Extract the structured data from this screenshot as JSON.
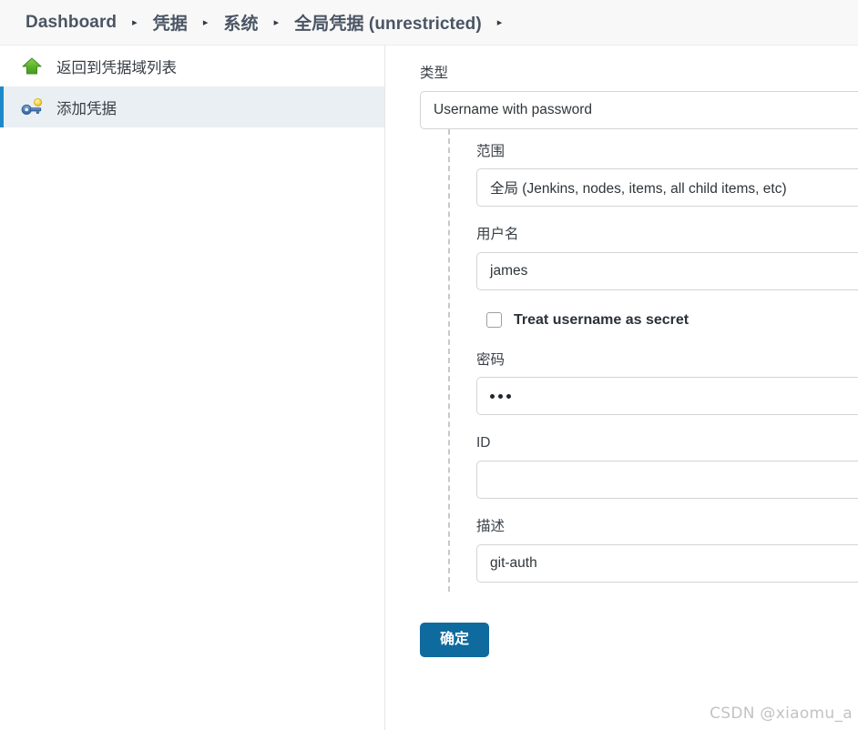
{
  "breadcrumb": {
    "separator": "▸",
    "items": [
      {
        "label": "Dashboard"
      },
      {
        "label": "凭据"
      },
      {
        "label": "系统"
      },
      {
        "label": "全局凭据 (unrestricted)"
      }
    ],
    "trailing_separator": "▸"
  },
  "sidebar": {
    "items": [
      {
        "label": "返回到凭据域列表",
        "icon": "green-up-arrow-icon",
        "active": false
      },
      {
        "label": "添加凭据",
        "icon": "key-add-icon",
        "active": true
      }
    ]
  },
  "form": {
    "type": {
      "label": "类型",
      "value": "Username with password"
    },
    "scope": {
      "label": "范围",
      "value": "全局 (Jenkins, nodes, items, all child items, etc)"
    },
    "username": {
      "label": "用户名",
      "value": "james",
      "placeholder": ""
    },
    "treat_as_secret": {
      "label": "Treat username as secret",
      "checked": false
    },
    "password": {
      "label": "密码",
      "value": "•••",
      "masked_dot_count": 3
    },
    "id": {
      "label": "ID",
      "value": "",
      "placeholder": ""
    },
    "description": {
      "label": "描述",
      "value": "git-auth",
      "placeholder": ""
    },
    "submit": {
      "label": "确定"
    }
  },
  "watermark": {
    "text": "CSDN @xiaomu_a"
  },
  "colors": {
    "accent": "#1d89c9",
    "button": "#0f6a9e",
    "breadcrumb_text": "#4a5564",
    "active_sidebar_bg": "#e9eff3"
  }
}
